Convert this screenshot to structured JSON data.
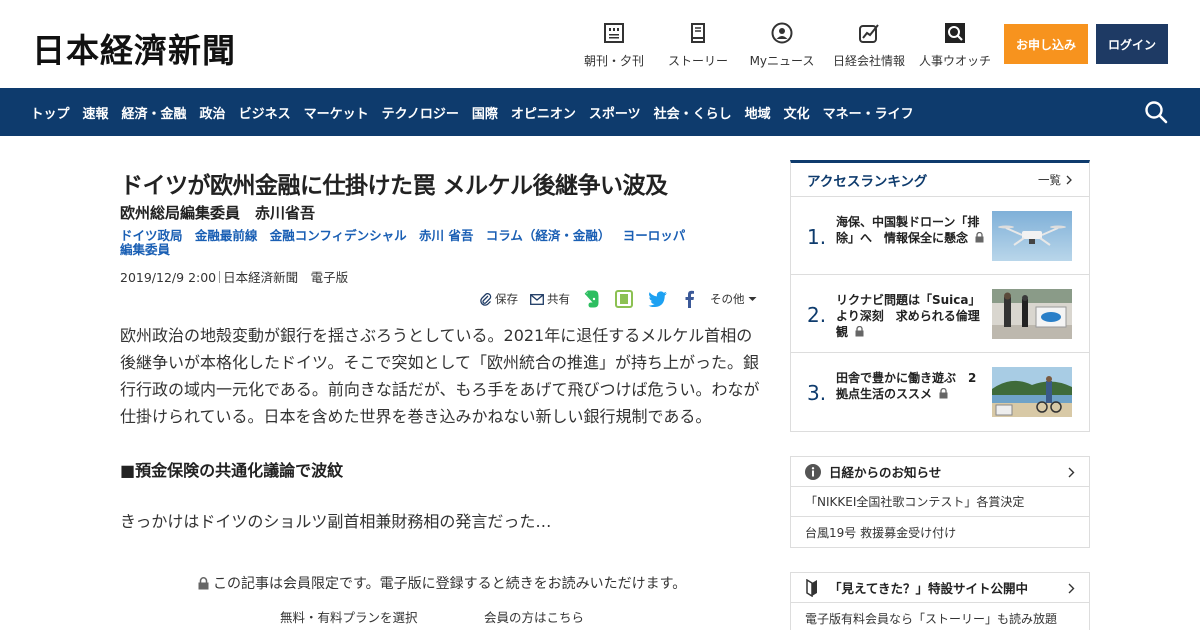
{
  "header": {
    "logo": "日本経濟新聞",
    "nav": [
      {
        "label": "朝刊・夕刊",
        "icon": "newspaper-icon"
      },
      {
        "label": "ストーリー",
        "icon": "book-icon"
      },
      {
        "label": "Myニュース",
        "icon": "user-icon"
      },
      {
        "label": "日経会社情報",
        "icon": "chart-icon"
      },
      {
        "label": "人事ウオッチ",
        "icon": "search-person-icon"
      }
    ],
    "apply_label": "お申し込み",
    "login_label": "ログイン"
  },
  "navbar": {
    "items": [
      "トップ",
      "速報",
      "経済・金融",
      "政治",
      "ビジネス",
      "マーケット",
      "テクノロジー",
      "国際",
      "オピニオン",
      "スポーツ",
      "社会・くらし",
      "地域",
      "文化",
      "マネー・ライフ"
    ]
  },
  "article": {
    "title": "ドイツが欧州金融に仕掛けた罠 メルケル後継争い波及",
    "byline": "欧州総局編集委員　赤川省吾",
    "tags": [
      "ドイツ政局",
      "金融最前線",
      "金融コンフィデンシャル",
      "赤川 省吾",
      "コラム（経済・金融）",
      "ヨーロッパ",
      "編集委員"
    ],
    "date": "2019/12/9 2:00",
    "source": "日本経済新聞　電子版",
    "share": {
      "save": "保存",
      "share": "共有",
      "other": "その他"
    },
    "body": "欧州政治の地殻変動が銀行を揺さぶろうとしている。2021年に退任するメルケル首相の後継争いが本格化したドイツ。そこで突如として「欧州統合の推進」が持ち上がった。銀行行政の域内一元化である。前向きな話だが、もろ手をあげて飛びつけば危うい。わなが仕掛けられている。日本を含めた世界を巻き込みかねない新しい銀行規制である。",
    "subhead": "■預金保険の共通化議論で波紋",
    "lead": "きっかけはドイツのショルツ副首相兼財務相の発言だった…",
    "paywall": "この記事は会員限定です。電子版に登録すると続きをお読みいただけます。",
    "plan_link": "無料・有料プランを選択",
    "member_link": "会員の方はこちら"
  },
  "sidebar": {
    "ranking_title": "アクセスランキング",
    "ranking_all": "一覧",
    "ranking": [
      {
        "rank": "1.",
        "text": "海保、中国製ドローン「排除」へ　情報保全に懸念"
      },
      {
        "rank": "2.",
        "text": "リクナビ問題は「Suica」より深刻　求められる倫理観"
      },
      {
        "rank": "3.",
        "text": "田舎で豊かに働き遊ぶ　2拠点生活のススメ"
      }
    ],
    "notice_title": "日経からのお知らせ",
    "notices": [
      "「NIKKEI全国社歌コンテスト」各賞決定",
      "台風19号 救援募金受け付け"
    ],
    "special_title": "「見えてきた？」特設サイト公開中",
    "special_text": "電子版有料会員なら「ストーリー」も読み放題"
  },
  "colors": {
    "navy": "#0e3b6d",
    "orange": "#f7931e",
    "login": "#1e3a64",
    "link": "#1a5fb4"
  }
}
